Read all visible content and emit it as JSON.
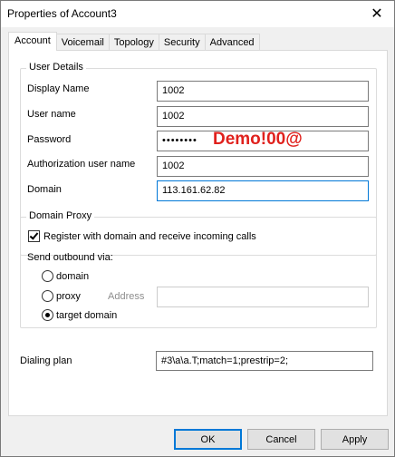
{
  "window": {
    "title": "Properties of Account3",
    "close_icon": "close-icon"
  },
  "tabs": [
    {
      "label": "Account"
    },
    {
      "label": "Voicemail"
    },
    {
      "label": "Topology"
    },
    {
      "label": "Security"
    },
    {
      "label": "Advanced"
    }
  ],
  "user_details": {
    "group_label": "User Details",
    "display_name": {
      "label": "Display Name",
      "value": "1002"
    },
    "user_name": {
      "label": "User name",
      "value": "1002"
    },
    "password": {
      "label": "Password",
      "value": "••••••••",
      "annotation": "Demo!00@"
    },
    "auth_user_name": {
      "label": "Authorization user name",
      "value": "1002"
    },
    "domain": {
      "label": "Domain",
      "value": "113.161.62.82"
    }
  },
  "domain_proxy": {
    "group_label": "Domain Proxy",
    "register_checkbox": {
      "label": "Register with domain and receive incoming calls",
      "checked": true
    },
    "send_outbound_label": "Send outbound via:",
    "radio_domain": "domain",
    "radio_proxy": "proxy",
    "address_label": "Address",
    "address_value": "",
    "radio_target": "target domain",
    "selected": "target domain"
  },
  "dialing_plan": {
    "label": "Dialing plan",
    "value": "#3\\a\\a.T;match=1;prestrip=2;"
  },
  "buttons": {
    "ok": "OK",
    "cancel": "Cancel",
    "apply": "Apply"
  },
  "colors": {
    "accent": "#0078d7",
    "annotation": "#e0211d"
  }
}
